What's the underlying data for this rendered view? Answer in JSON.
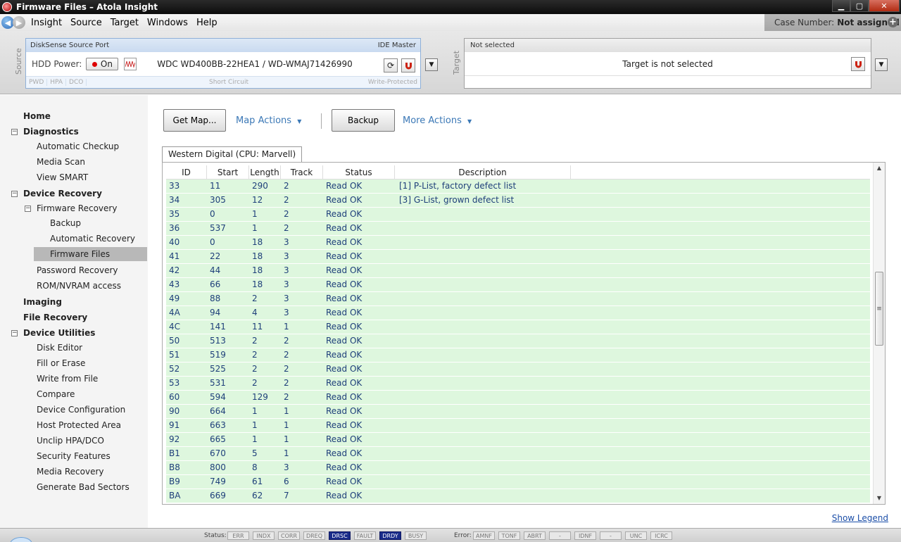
{
  "window": {
    "title": "Firmware Files – Atola Insight"
  },
  "menu": [
    "Insight",
    "Source",
    "Target",
    "Windows",
    "Help"
  ],
  "case": {
    "label": "Case Number:",
    "value": "Not assigned"
  },
  "source": {
    "vlabel": "Source",
    "port": "DiskSense Source Port",
    "mode": "IDE Master",
    "hdd_power_label": "HDD Power:",
    "power_state": "On",
    "drive": "WDC WD400BB-22HEA1 / WD-WMAJ71426990",
    "tags": [
      "PWD",
      "HPA",
      "DCO"
    ],
    "short_circuit": "Short Circuit",
    "write_protected": "Write-Protected"
  },
  "target": {
    "vlabel": "Target",
    "header": "Not selected",
    "message": "Target is not selected"
  },
  "nav": {
    "home": "Home",
    "diagnostics": "Diagnostics",
    "automatic_checkup": "Automatic Checkup",
    "media_scan": "Media Scan",
    "view_smart": "View SMART",
    "device_recovery": "Device Recovery",
    "firmware_recovery": "Firmware Recovery",
    "backup": "Backup",
    "automatic_recovery": "Automatic Recovery",
    "firmware_files": "Firmware Files",
    "password_recovery": "Password Recovery",
    "rom_nvram": "ROM/NVRAM access",
    "imaging": "Imaging",
    "file_recovery": "File Recovery",
    "device_utilities": "Device Utilities",
    "disk_editor": "Disk Editor",
    "fill_erase": "Fill or Erase",
    "write_from_file": "Write from File",
    "compare": "Compare",
    "device_configuration": "Device Configuration",
    "host_protected_area": "Host Protected Area",
    "unclip_hpa_dco": "Unclip HPA/DCO",
    "security_features": "Security Features",
    "media_recovery": "Media Recovery",
    "generate_bad_sectors": "Generate Bad Sectors"
  },
  "toolbar": {
    "get_map": "Get Map...",
    "map_actions": "Map Actions",
    "backup": "Backup",
    "more_actions": "More Actions"
  },
  "tab": "Western Digital (CPU: Marvell)",
  "table": {
    "columns": [
      "ID",
      "Start",
      "Length",
      "Track",
      "Status",
      "Description"
    ],
    "rows": [
      [
        "33",
        "11",
        "290",
        "2",
        "Read OK",
        "[1] P-List, factory defect list"
      ],
      [
        "34",
        "305",
        "12",
        "2",
        "Read OK",
        "[3] G-List, grown defect list"
      ],
      [
        "35",
        "0",
        "1",
        "2",
        "Read OK",
        ""
      ],
      [
        "36",
        "537",
        "1",
        "2",
        "Read OK",
        ""
      ],
      [
        "40",
        "0",
        "18",
        "3",
        "Read OK",
        ""
      ],
      [
        "41",
        "22",
        "18",
        "3",
        "Read OK",
        ""
      ],
      [
        "42",
        "44",
        "18",
        "3",
        "Read OK",
        ""
      ],
      [
        "43",
        "66",
        "18",
        "3",
        "Read OK",
        ""
      ],
      [
        "49",
        "88",
        "2",
        "3",
        "Read OK",
        ""
      ],
      [
        "4A",
        "94",
        "4",
        "3",
        "Read OK",
        ""
      ],
      [
        "4C",
        "141",
        "11",
        "1",
        "Read OK",
        ""
      ],
      [
        "50",
        "513",
        "2",
        "2",
        "Read OK",
        ""
      ],
      [
        "51",
        "519",
        "2",
        "2",
        "Read OK",
        ""
      ],
      [
        "52",
        "525",
        "2",
        "2",
        "Read OK",
        ""
      ],
      [
        "53",
        "531",
        "2",
        "2",
        "Read OK",
        ""
      ],
      [
        "60",
        "594",
        "129",
        "2",
        "Read OK",
        ""
      ],
      [
        "90",
        "664",
        "1",
        "1",
        "Read OK",
        ""
      ],
      [
        "91",
        "663",
        "1",
        "1",
        "Read OK",
        ""
      ],
      [
        "92",
        "665",
        "1",
        "1",
        "Read OK",
        ""
      ],
      [
        "B1",
        "670",
        "5",
        "1",
        "Read OK",
        ""
      ],
      [
        "B8",
        "800",
        "8",
        "3",
        "Read OK",
        ""
      ],
      [
        "B9",
        "749",
        "61",
        "6",
        "Read OK",
        ""
      ],
      [
        "BA",
        "669",
        "62",
        "7",
        "Read OK",
        ""
      ]
    ]
  },
  "show_legend": "Show Legend",
  "status": {
    "label": "Status:",
    "indicators": [
      "ERR",
      "INDX",
      "CORR",
      "DREQ",
      "DRSC",
      "FAULT",
      "DRDY",
      "BUSY"
    ],
    "active": [
      "DRSC",
      "DRDY"
    ]
  },
  "error": {
    "label": "Error:",
    "indicators": [
      "AMNF",
      "TONF",
      "ABRT",
      "-",
      "IDNF",
      "-",
      "UNC",
      "ICRC"
    ]
  },
  "colors": {
    "row_bg": "#def7de",
    "row_text": "#1e3f7a",
    "link": "#3b78b6",
    "active_indicator": "#1a2c8a"
  }
}
